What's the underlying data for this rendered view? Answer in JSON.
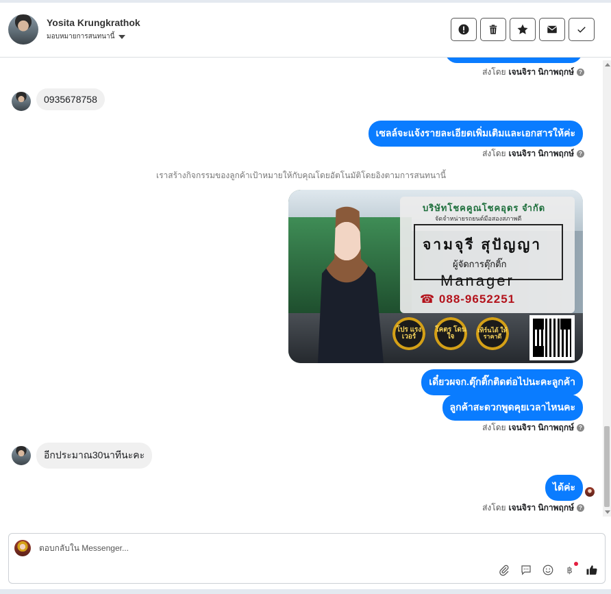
{
  "header": {
    "contact_name": "Yosita Krungkrathok",
    "assign_label": "มอบหมายการสนทนานี้",
    "actions": [
      {
        "name": "report-button",
        "icon": "exclamation-icon"
      },
      {
        "name": "delete-button",
        "icon": "trash-icon"
      },
      {
        "name": "star-button",
        "icon": "star-icon"
      },
      {
        "name": "mark-unread-button",
        "icon": "envelope-icon"
      },
      {
        "name": "mark-done-button",
        "icon": "check-icon"
      }
    ]
  },
  "messages": {
    "sent_by_prefix": "ส่งโดย",
    "sender_name": "เจนจิรา นิกาพฤกษ์",
    "m1_in": "0935678758",
    "m2_out": "เซลล์จะแจ้งรายละเอียดเพิ่มเติมและเอกสารให้ค่ะ",
    "system_note": "เราสร้างกิจกรรมของลูกค้าเป้าหมายให้กับคุณโดยอัตโนมัติโดยอิงตามการสนทนานี้",
    "m3_out": "เดี๋ยวผจก.ตุ๊กติ๊กติดต่อไปนะคะลูกค้า",
    "m4_out": "ลูกค้าสะดวกพูดคุยเวลาไหนคะ",
    "m5_in": "อีกประมาณ30นาทีนะคะ",
    "m6_out": "ได้ค่ะ"
  },
  "card": {
    "company": "บริษัทโชคคูณโชคอุดร จำกัด",
    "tagline": "จัดจำหน่ายรถยนต์มือสองสภาพดี",
    "person_name": "จามจุรี สุปัญญา",
    "role": "ผู้จัดการตุ๊กติ๊ก",
    "title_en": "Manager",
    "phone": "088-9652251",
    "badges": [
      "โปร แรง เวอร์",
      "โคตร โดนใจ",
      "เทิร์นได้ ให้ราคาดี"
    ]
  },
  "composer": {
    "placeholder": "ตอบกลับใน Messenger..."
  },
  "colors": {
    "accent": "#0a7cff",
    "incoming_bubble": "#f0f0f0",
    "phone_red": "#b3121b"
  }
}
